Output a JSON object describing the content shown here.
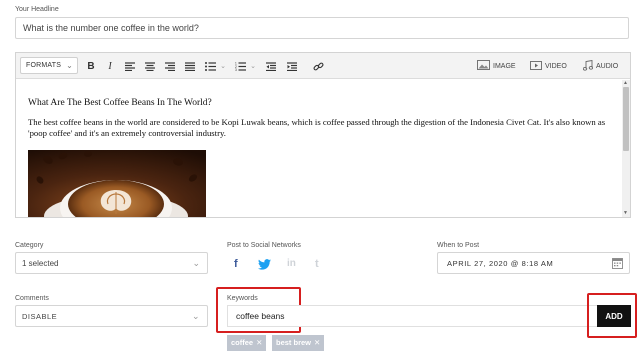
{
  "headline": {
    "label": "Your Headline",
    "value": "What is the number one coffee in the world?"
  },
  "toolbar": {
    "formats_label": "FORMATS",
    "image_label": "IMAGE",
    "video_label": "VIDEO",
    "audio_label": "AUDIO"
  },
  "editor": {
    "heading": "What Are The Best Coffee Beans In The World?",
    "paragraph": "The best coffee beans in the world are considered to be Kopi Luwak beans, which is coffee passed through the digestion of the Indonesia Civet Cat. It's also known as 'poop coffee' and it's an extremely controversial industry."
  },
  "category": {
    "label": "Category",
    "value": "1 selected"
  },
  "social": {
    "label": "Post to Social Networks"
  },
  "when": {
    "label": "When to Post",
    "value": "APRIL 27, 2020 @ 8:18 AM"
  },
  "comments": {
    "label": "Comments",
    "value": "DISABLE"
  },
  "keywords": {
    "label": "Keywords",
    "value": "coffee beans",
    "add_label": "ADD",
    "tags": [
      "coffee",
      "best brew"
    ]
  },
  "colors": {
    "highlight": "#d61f1f",
    "facebook": "#3b5998",
    "twitter": "#1da1f2",
    "disabled": "#cfd3d8",
    "tag_bg": "#bfc5cf"
  }
}
